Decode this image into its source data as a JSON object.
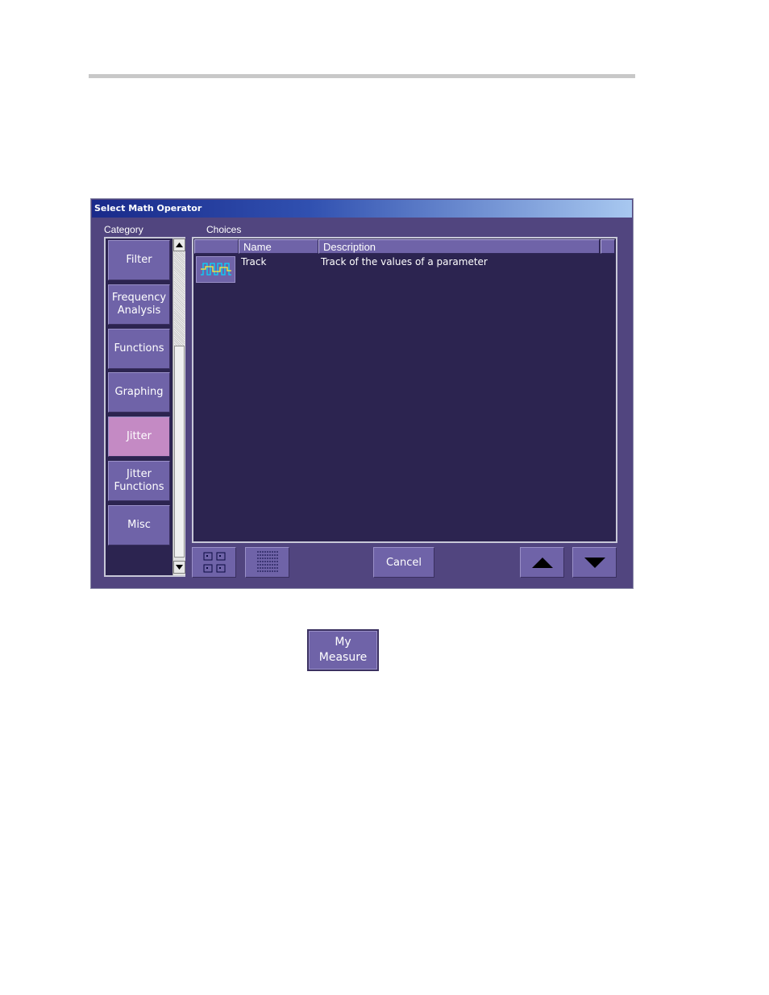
{
  "dialog": {
    "title": "Select Math Operator",
    "category_label": "Category",
    "choices_label": "Choices"
  },
  "categories": [
    {
      "label": "Filter",
      "active": false
    },
    {
      "label": "Frequency\nAnalysis",
      "active": false
    },
    {
      "label": "Functions",
      "active": false
    },
    {
      "label": "Graphing",
      "active": false
    },
    {
      "label": "Jitter",
      "active": true
    },
    {
      "label": "Jitter\nFunctions",
      "active": false
    },
    {
      "label": "Misc",
      "active": false
    }
  ],
  "table": {
    "columns": [
      "Name",
      "Description"
    ],
    "rows": [
      {
        "icon": "track-waveform-icon",
        "name": "Track",
        "description": "Track of the values of a parameter"
      }
    ]
  },
  "toolbar": {
    "cancel_label": "Cancel"
  },
  "my_measure_label": "My\nMeasure",
  "colors": {
    "dialog_bg": "#51457f",
    "panel_bg": "#2c2450",
    "button": "#6f63a8",
    "active_button": "#c48ac4"
  }
}
